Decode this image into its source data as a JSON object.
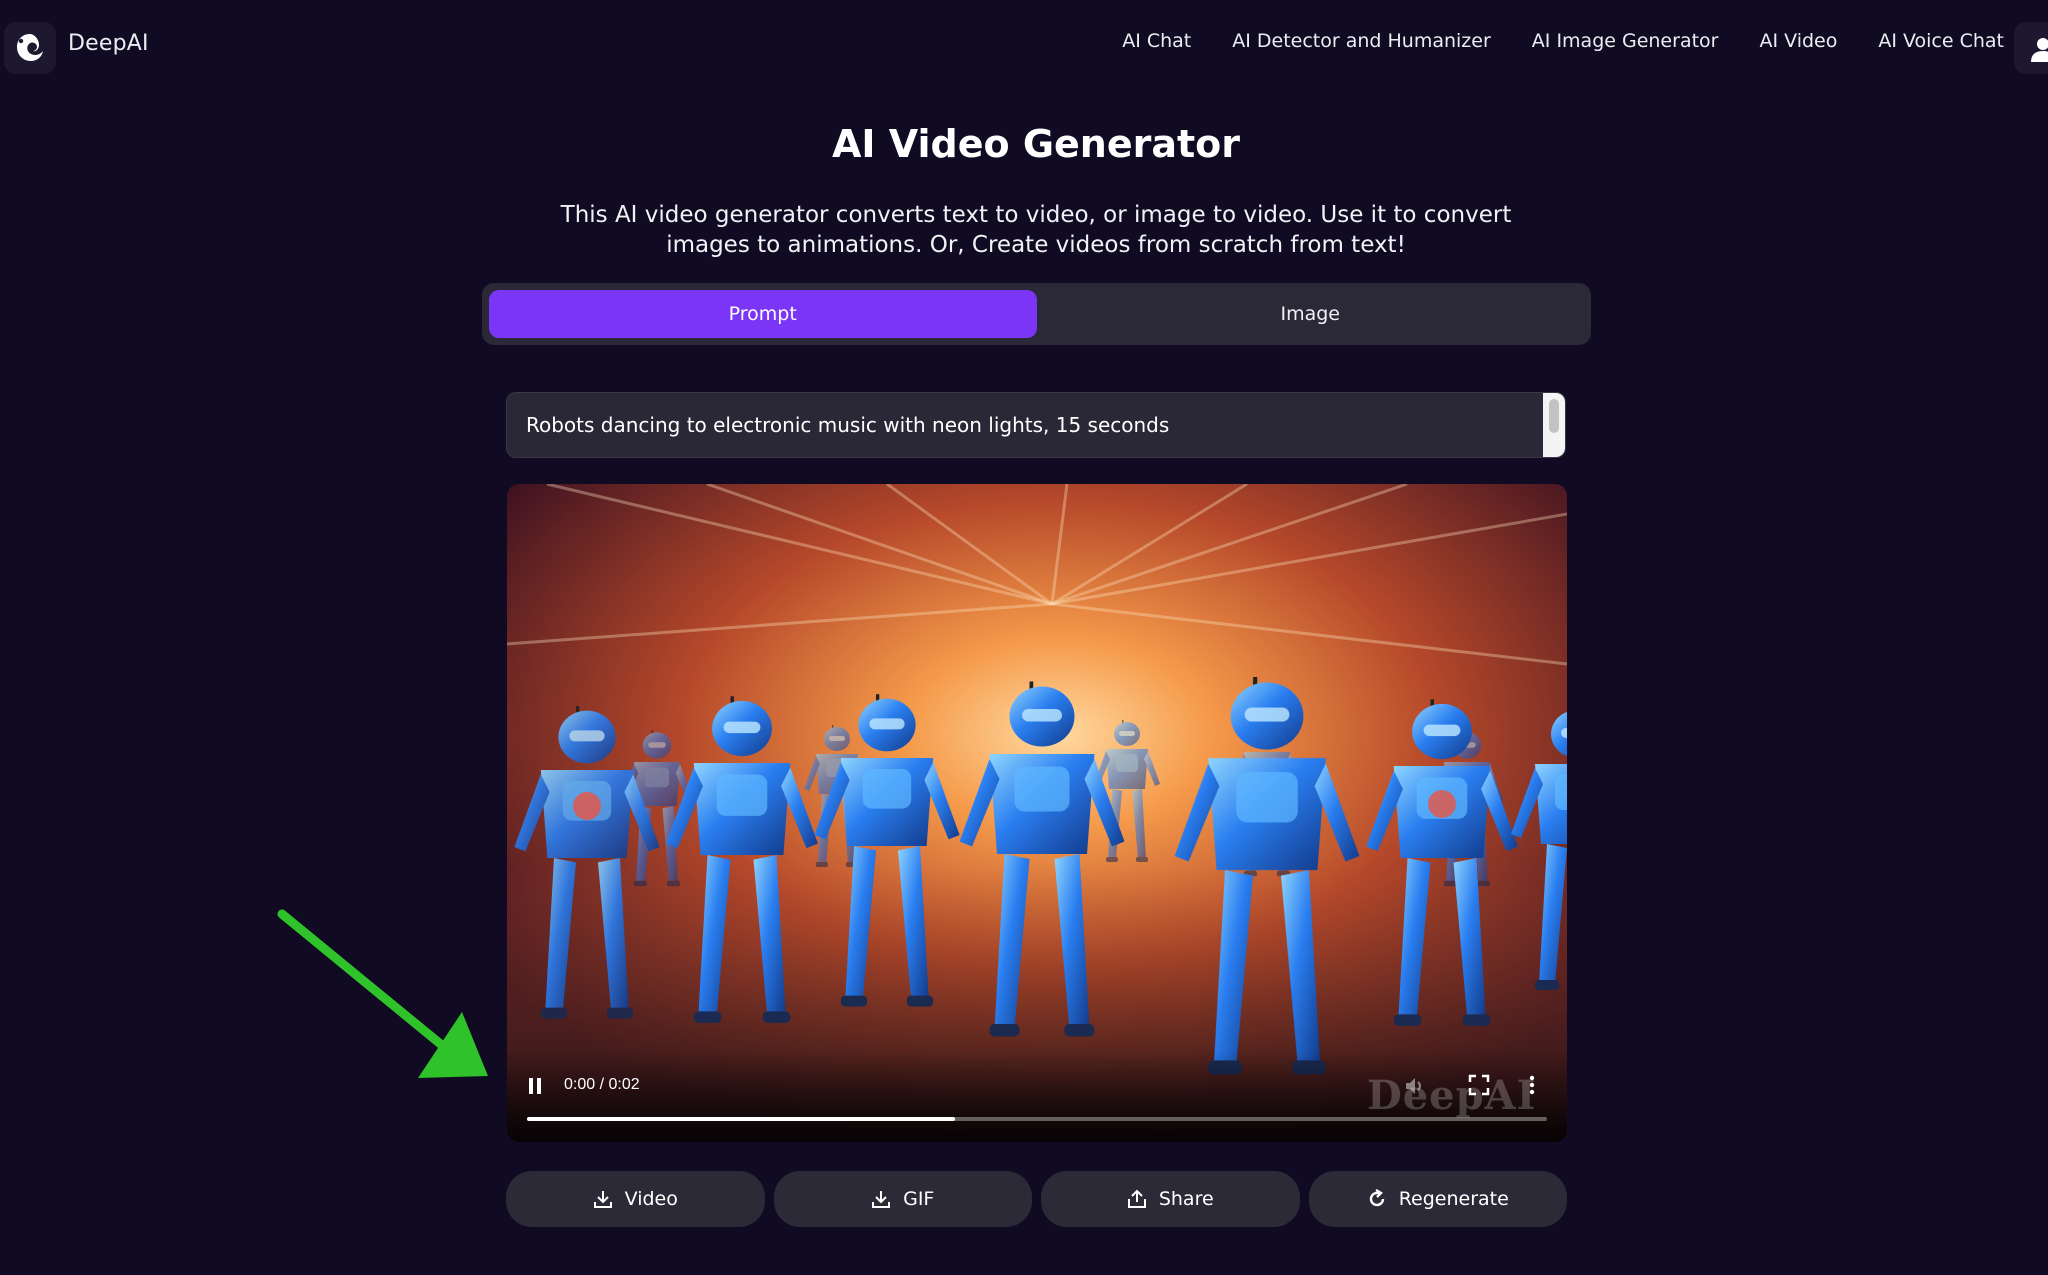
{
  "nav": {
    "brand": "DeepAI",
    "links": [
      "AI Chat",
      "AI Detector and Humanizer",
      "AI Image Generator",
      "AI Video",
      "AI Voice Chat"
    ]
  },
  "hero": {
    "title": "AI Video Generator",
    "description": "This AI video generator converts text to video, or image to video. Use it to convert images to animations. Or, Create videos from scratch from text!"
  },
  "tabs": [
    {
      "label": "Prompt",
      "active": true
    },
    {
      "label": "Image",
      "active": false
    }
  ],
  "prompt": {
    "value": "Robots dancing to electronic music with neon lights, 15 seconds"
  },
  "video": {
    "time": "0:00 / 0:02",
    "progress": 0.42,
    "watermark": "DeepAI",
    "state": "playing"
  },
  "actions": {
    "video": "Video",
    "gif": "GIF",
    "share": "Share",
    "regenerate": "Regenerate"
  },
  "colors": {
    "background": "#100b22",
    "accent": "#7b35f7",
    "annotation_arrow": "#2fc22a"
  },
  "icons": {
    "logo": "deepai-logo-icon",
    "user": "user-icon",
    "pause": "pause-icon",
    "volume": "volume-icon",
    "fullscreen": "fullscreen-icon",
    "more": "more-vertical-icon",
    "download": "download-icon",
    "share": "share-icon",
    "regenerate": "refresh-icon"
  }
}
